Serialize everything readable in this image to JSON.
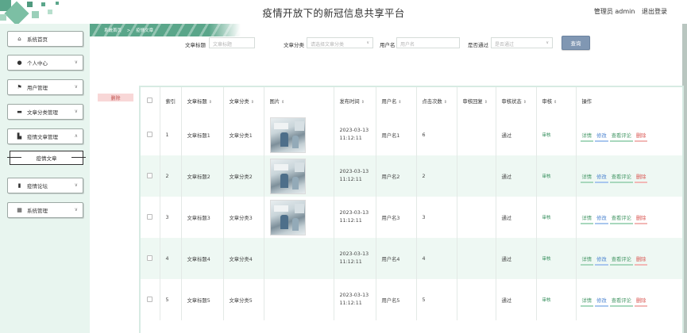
{
  "header": {
    "title": "疫情开放下的新冠信息共享平台",
    "user_label": "管理员 admin",
    "logout_label": "退出登录"
  },
  "sidebar": {
    "items": [
      {
        "label": "系统首页",
        "icon": "home-icon"
      },
      {
        "label": "个人中心",
        "icon": "user-icon"
      },
      {
        "label": "用户管理",
        "icon": "flag-icon"
      },
      {
        "label": "文章分类管理",
        "icon": "category-icon"
      },
      {
        "label": "疫情文章管理",
        "icon": "article-icon"
      },
      {
        "label": "疫情论坛",
        "icon": "chart-icon"
      },
      {
        "label": "系统管理",
        "icon": "grid-icon"
      }
    ],
    "submenu": {
      "label": "疫情文章"
    }
  },
  "breadcrumb": {
    "home": "系统首页",
    "separator": ">",
    "current": "疫情文章"
  },
  "search": {
    "title_label": "文章标题",
    "title_placeholder": "文章标题",
    "category_label": "文章分类",
    "category_placeholder": "请选择文章分类",
    "user_label": "用户名",
    "user_placeholder": "用户名",
    "passed_label": "是否通过",
    "passed_placeholder": "是否通过",
    "button": "查询"
  },
  "actions": {
    "delete": "删除"
  },
  "table": {
    "headers": [
      "索引",
      "文章标题",
      "文章分类",
      "图片",
      "发布时间",
      "用户名",
      "点击次数",
      "审核回复",
      "审核状态",
      "审核",
      "操作"
    ],
    "rows": [
      {
        "index": "1",
        "title": "文章标题1",
        "category": "文章分类1",
        "has_image": true,
        "time": "2023-03-13 11:12:11",
        "user": "用户名1",
        "clicks": "6",
        "reply": "",
        "status": "通过",
        "audit": "审核"
      },
      {
        "index": "2",
        "title": "文章标题2",
        "category": "文章分类2",
        "has_image": true,
        "time": "2023-03-13 11:12:11",
        "user": "用户名2",
        "clicks": "2",
        "reply": "",
        "status": "通过",
        "audit": "审核"
      },
      {
        "index": "3",
        "title": "文章标题3",
        "category": "文章分类3",
        "has_image": true,
        "time": "2023-03-13 11:12:11",
        "user": "用户名3",
        "clicks": "3",
        "reply": "",
        "status": "通过",
        "audit": "审核"
      },
      {
        "index": "4",
        "title": "文章标题4",
        "category": "文章分类4",
        "has_image": false,
        "time": "2023-03-13 11:12:11",
        "user": "用户名4",
        "clicks": "4",
        "reply": "",
        "status": "通过",
        "audit": "审核"
      },
      {
        "index": "5",
        "title": "文章标题5",
        "category": "文章分类5",
        "has_image": false,
        "time": "2023-03-13 11:12:11",
        "user": "用户名5",
        "clicks": "5",
        "reply": "",
        "status": "通过",
        "audit": "审核"
      }
    ],
    "ops": {
      "detail": "详情",
      "edit": "修改",
      "review": "查看评论",
      "delete": "删除"
    }
  },
  "colors": {
    "accent": "#5ba68b",
    "sidebar_bg": "#e8f5ef",
    "row_alt": "#eef8f3",
    "query_button": "#8097b3",
    "delete": "#d9534f"
  }
}
